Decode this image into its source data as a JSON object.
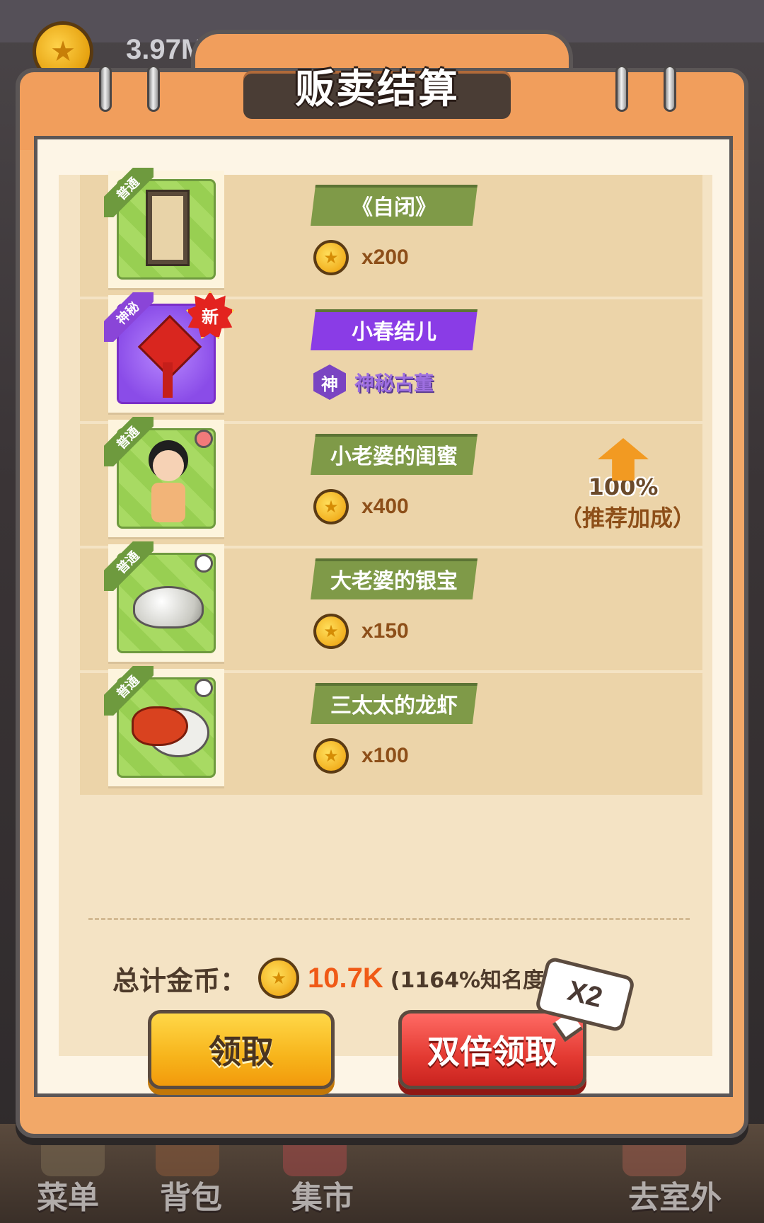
{
  "top": {
    "currency": "3.97M"
  },
  "dialog": {
    "title": "贩卖结算",
    "items": [
      {
        "tag": "普通",
        "name": "《自闭》",
        "price": "x200"
      },
      {
        "tag": "神秘",
        "name": "小春结儿",
        "badge": "新",
        "type_icon": "神",
        "type_label": "神秘古董"
      },
      {
        "tag": "普通",
        "name": "小老婆的闺蜜",
        "price": "x400",
        "bonus_pct": "100%",
        "bonus_label": "（推荐加成）"
      },
      {
        "tag": "普通",
        "name": "大老婆的银宝",
        "price": "x150"
      },
      {
        "tag": "普通",
        "name": "三太太的龙虾",
        "price": "x100"
      }
    ],
    "total_label": "总计金币：",
    "total_value": "10.7K",
    "total_note": "(1164%知名度加成)",
    "claim_label": "领取",
    "double_label": "双倍领取",
    "x2_tag": "X2"
  },
  "nav": {
    "menu": "菜单",
    "bag": "背包",
    "market": "集市",
    "outside": "去室外"
  },
  "colors": {
    "accent": "#f19e5c",
    "coin": "#f2b020",
    "total": "#f05a16",
    "common": "#7f9a48",
    "mystic": "#8a3ce6"
  }
}
